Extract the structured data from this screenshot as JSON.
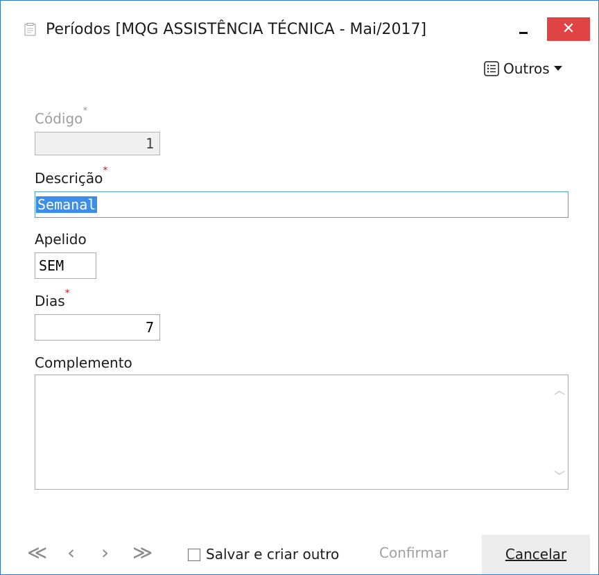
{
  "window": {
    "title": "Períodos [MQG ASSISTÊNCIA TÉCNICA - Mai/2017]",
    "close_glyph": "✕"
  },
  "toolbar": {
    "outros_label": "Outros",
    "outros_icon": "list-icon",
    "dropdown_icon": "caret-down-icon"
  },
  "form": {
    "codigo": {
      "label": "Código",
      "value": "1",
      "required_mark": "*",
      "disabled": true
    },
    "descricao": {
      "label": "Descrição",
      "value": "Semanal",
      "required_mark": "*"
    },
    "apelido": {
      "label": "Apelido",
      "value": "SEM"
    },
    "dias": {
      "label": "Dias",
      "value": "7",
      "required_mark": "*"
    },
    "complemento": {
      "label": "Complemento",
      "value": ""
    }
  },
  "footer": {
    "nav": {
      "first": "≪",
      "prev": "‹",
      "next": "›",
      "last": "≫"
    },
    "salvar_criar_outro": {
      "label": "Salvar e criar outro",
      "checked": false
    },
    "confirm_label": "Confirmar",
    "cancel_label": "Cancelar"
  },
  "colors": {
    "accent": "#2b79d6",
    "close": "#e04343",
    "selection": "#3e8de6",
    "required": "#d4101f"
  }
}
